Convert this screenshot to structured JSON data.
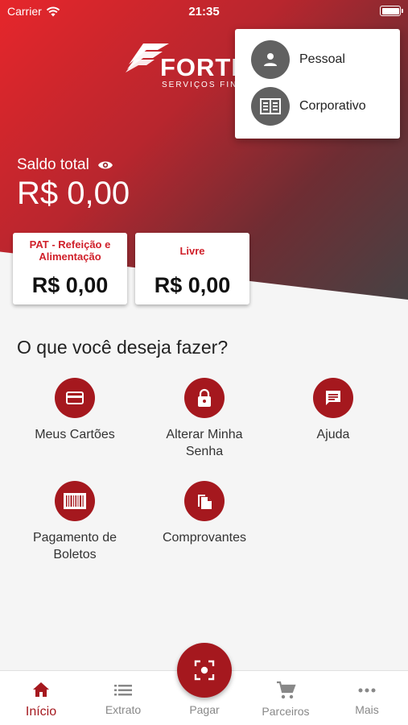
{
  "status_bar": {
    "carrier": "Carrier",
    "time": "21:35"
  },
  "logo": {
    "wordmark": "FORTE",
    "tagline": "SERVIÇOS FIN"
  },
  "account_menu": {
    "items": [
      {
        "label": "Pessoal",
        "icon": "person-icon"
      },
      {
        "label": "Corporativo",
        "icon": "building-icon"
      }
    ]
  },
  "balance": {
    "label": "Saldo total",
    "value": "R$ 0,00"
  },
  "wallets": [
    {
      "title": "PAT - Refeição e Alimentação",
      "value": "R$ 0,00"
    },
    {
      "title": "Livre",
      "value": "R$ 0,00"
    }
  ],
  "actions_title": "O que você deseja fazer?",
  "actions": [
    {
      "label": "Meus Cartões",
      "icon": "credit-card-icon"
    },
    {
      "label": "Alterar Minha Senha",
      "icon": "lock-icon"
    },
    {
      "label": "Ajuda",
      "icon": "chat-icon"
    },
    {
      "label": "Pagamento de Boletos",
      "icon": "barcode-icon"
    },
    {
      "label": "Comprovantes",
      "icon": "documents-icon"
    }
  ],
  "bottom_nav": [
    {
      "label": "Início",
      "icon": "home-icon",
      "active": true
    },
    {
      "label": "Extrato",
      "icon": "list-icon"
    },
    {
      "label": "Pagar",
      "icon": "scan-icon"
    },
    {
      "label": "Parceiros",
      "icon": "cart-icon"
    },
    {
      "label": "Mais",
      "icon": "more-icon"
    }
  ],
  "colors": {
    "primary": "#a5181e",
    "accent": "#d0202a",
    "menu_icon_bg": "#616161"
  }
}
